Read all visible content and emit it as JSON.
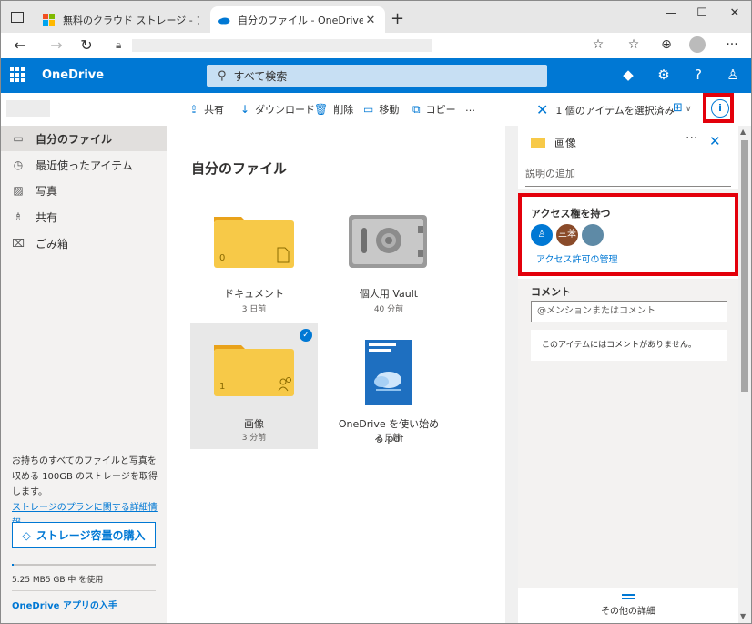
{
  "browser": {
    "tabs": [
      {
        "title": "無料のクラウド ストレージ - ファイル共"
      },
      {
        "title": "自分のファイル - OneDrive"
      }
    ]
  },
  "header": {
    "brand": "OneDrive",
    "search_placeholder": "すべて検索"
  },
  "commands": {
    "share": "共有",
    "download": "ダウンロード",
    "delete": "削除",
    "move": "移動",
    "copy": "コピー",
    "more": "…",
    "selection": "1 個のアイテムを選択済み"
  },
  "sidebar": {
    "items": [
      {
        "label": "自分のファイル",
        "icon": "folder-icon"
      },
      {
        "label": "最近使ったアイテム",
        "icon": "history-icon"
      },
      {
        "label": "写真",
        "icon": "photo-icon"
      },
      {
        "label": "共有",
        "icon": "people-icon"
      },
      {
        "label": "ごみ箱",
        "icon": "trash-icon"
      }
    ],
    "storage_text": "お持ちのすべてのファイルと写真を収める 100GB のストレージを取得します。",
    "storage_link": "ストレージのプランに関する詳細情報。",
    "buy_button": "ストレージ容量の購入",
    "usage_text": "5.25 MB5 GB 中 を使用",
    "usage_fraction": 0.001,
    "app_link": "OneDrive アプリの入手"
  },
  "main": {
    "title": "自分のファイル",
    "items": [
      {
        "name": "ドキュメント",
        "meta": "3 日前",
        "count": "0"
      },
      {
        "name": "個人用 Vault",
        "meta": "40 分前"
      },
      {
        "name": "画像",
        "meta": "3 分前",
        "count": "1"
      },
      {
        "name": "OneDrive を使い始める.pdf",
        "meta": "2 日前"
      }
    ]
  },
  "details": {
    "title": "画像",
    "more": "···",
    "description_placeholder": "説明の追加",
    "access_title": "アクセス権を持つ",
    "avatar_initials": "三苯",
    "access_link": "アクセス許可の管理",
    "comment_label": "コメント",
    "comment_placeholder": "@メンションまたはコメント",
    "no_comments": "このアイテムにはコメントがありません。",
    "more_details": "その他の詳細"
  },
  "colors": {
    "accent": "#0078d4",
    "highlight": "#e3000b",
    "folder": "#f7c948"
  }
}
